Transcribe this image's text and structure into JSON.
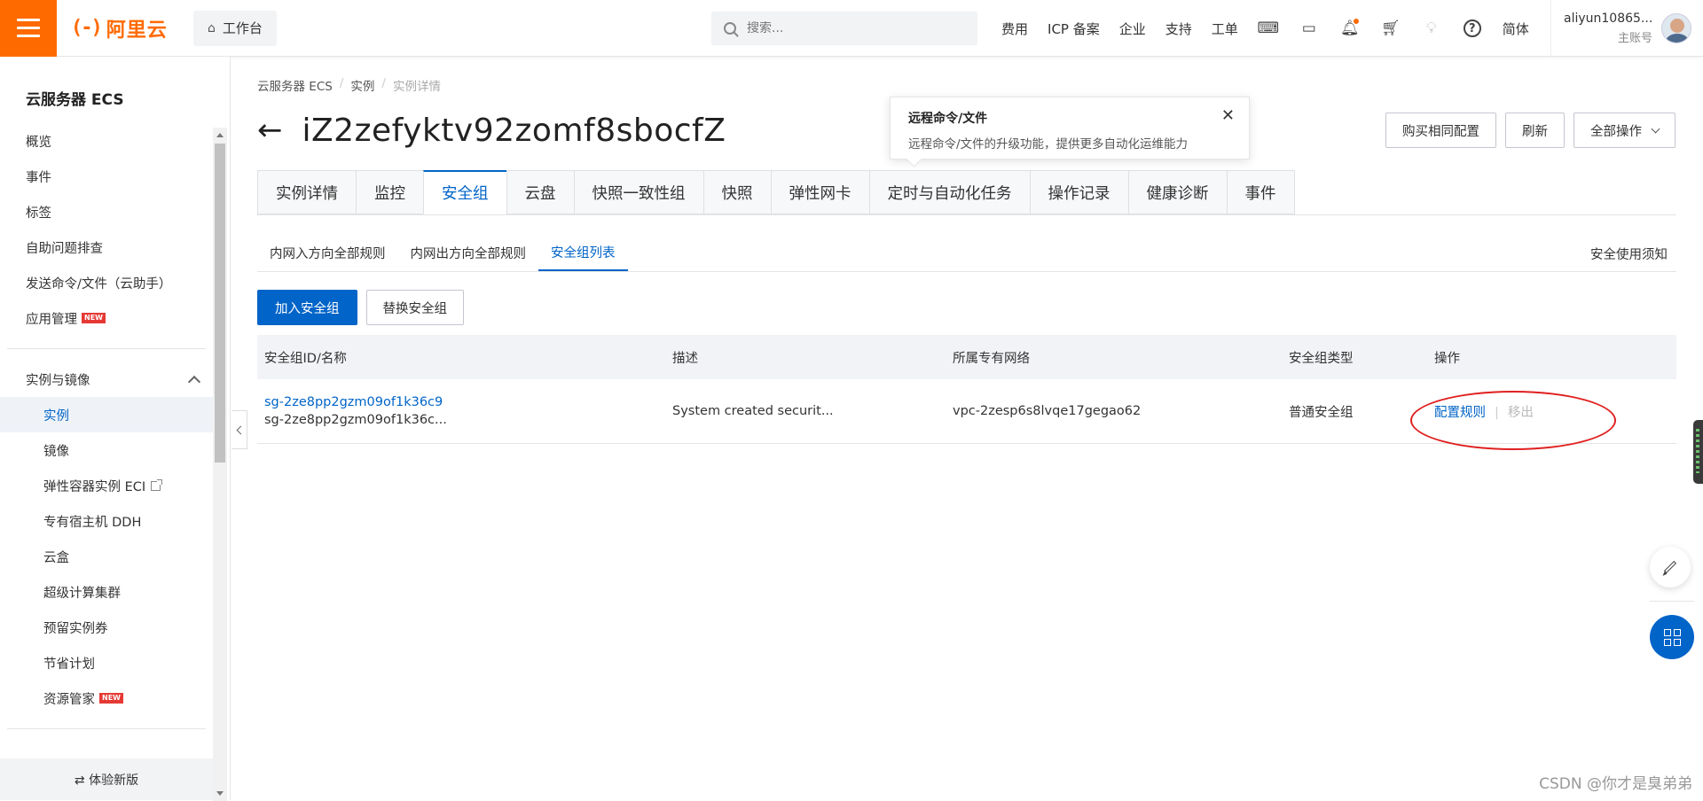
{
  "topbar": {
    "brand": "阿里云",
    "logo_mark": "(-)",
    "workbench": "工作台",
    "search_placeholder": "搜索...",
    "nav": [
      "费用",
      "ICP 备案",
      "企业",
      "支持",
      "工单"
    ],
    "icons": [
      "code-icon",
      "terminal-icon",
      "bell-icon",
      "cart-icon",
      "bulb-icon",
      "help-icon"
    ],
    "lang": "简体",
    "user_name": "aliyun10865...",
    "user_role": "主账号"
  },
  "sidebar": {
    "title": "云服务器 ECS",
    "items": [
      {
        "label": "概览"
      },
      {
        "label": "事件"
      },
      {
        "label": "标签"
      },
      {
        "label": "自助问题排查"
      },
      {
        "label": "发送命令/文件（云助手）"
      },
      {
        "label": "应用管理",
        "badge": "NEW"
      }
    ],
    "group": "实例与镜像",
    "sub_items": [
      {
        "label": "实例",
        "active": true
      },
      {
        "label": "镜像"
      },
      {
        "label": "弹性容器实例 ECI",
        "external": true
      },
      {
        "label": "专有宿主机 DDH"
      },
      {
        "label": "云盒"
      },
      {
        "label": "超级计算集群"
      },
      {
        "label": "预留实例券"
      },
      {
        "label": "节省计划"
      },
      {
        "label": "资源管家",
        "badge": "NEW"
      }
    ],
    "footer": "⇄ 体验新版"
  },
  "breadcrumb": [
    "云服务器 ECS",
    "实例",
    "实例详情"
  ],
  "page_title": "iZ2zefyktv92zomf8sbocfZ",
  "tooltip": {
    "title": "远程命令/文件",
    "body": "远程命令/文件的升级功能，提供更多自动化运维能力"
  },
  "header_buttons": {
    "buy_same": "购买相同配置",
    "refresh": "刷新",
    "all_ops": "全部操作"
  },
  "tabs": [
    "实例详情",
    "监控",
    "安全组",
    "云盘",
    "快照一致性组",
    "快照",
    "弹性网卡",
    "定时与自动化任务",
    "操作记录",
    "健康诊断",
    "事件"
  ],
  "active_tab": "安全组",
  "subtabs": [
    "内网入方向全部规则",
    "内网出方向全部规则",
    "安全组列表"
  ],
  "active_subtab": "安全组列表",
  "notice_link": "安全使用须知",
  "actions": {
    "add": "加入安全组",
    "replace": "替换安全组"
  },
  "table": {
    "columns": [
      "安全组ID/名称",
      "描述",
      "所属专有网络",
      "安全组类型",
      "操作"
    ],
    "rows": [
      {
        "id": "sg-2ze8pp2gzm09of1k36c9",
        "name": "sg-2ze8pp2gzm09of1k36c...",
        "desc": "System created securit...",
        "vpc": "vpc-2zesp6s8lvqe17gegao62",
        "type": "普通安全组",
        "op_config": "配置规则",
        "op_sep": "|",
        "op_remove": "移出"
      }
    ]
  },
  "watermark": "CSDN @你才是臭弟弟",
  "colors": {
    "brand_orange": "#ff6a00",
    "primary_blue": "#0064c8",
    "annotation_red": "#e02020"
  }
}
